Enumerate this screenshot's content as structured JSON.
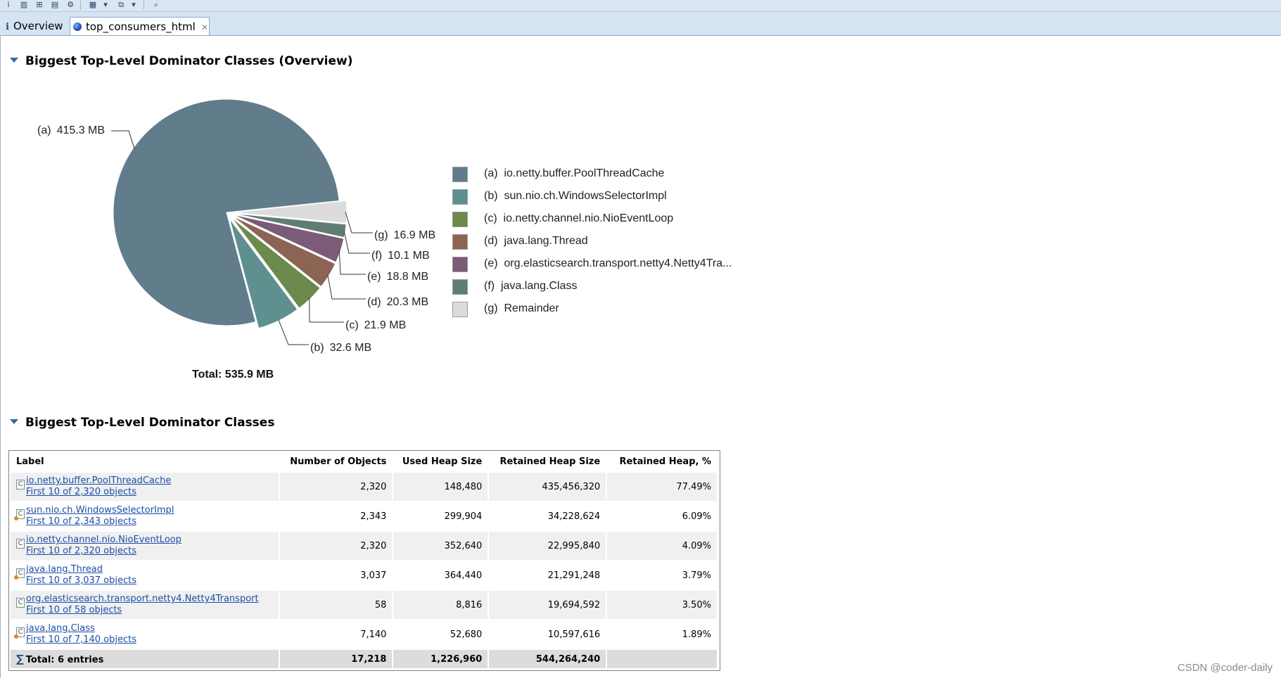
{
  "toolbar": {
    "icons": [
      "info-icon",
      "histogram-icon",
      "dominator-tree-icon",
      "oql-icon",
      "settings-icon",
      "query-browser-icon",
      "dropdown-icon",
      "heap-dump-overview-icon",
      "dropdown-icon",
      "search-icon"
    ]
  },
  "tabs": [
    {
      "label": "Overview",
      "icon": "info-icon"
    },
    {
      "label": "top_consumers_html",
      "icon": "globe-icon",
      "active": true
    }
  ],
  "section1": {
    "title": "Biggest Top-Level Dominator Classes (Overview)"
  },
  "section2": {
    "title": "Biggest Top-Level Dominator Classes"
  },
  "chart_data": {
    "type": "pie",
    "total_label": "Total: 535.9 MB",
    "slices": [
      {
        "key": "(a)",
        "name": "io.netty.buffer.PoolThreadCache",
        "value_mb": 415.3,
        "label": "415.3 MB",
        "color": "#617d8c"
      },
      {
        "key": "(b)",
        "name": "sun.nio.ch.WindowsSelectorImpl",
        "value_mb": 32.6,
        "label": "32.6 MB",
        "color": "#5f9090"
      },
      {
        "key": "(c)",
        "name": "io.netty.channel.nio.NioEventLoop",
        "value_mb": 21.9,
        "label": "21.9 MB",
        "color": "#6b8a4c"
      },
      {
        "key": "(d)",
        "name": "java.lang.Thread",
        "value_mb": 20.3,
        "label": "20.3 MB",
        "color": "#8c6454"
      },
      {
        "key": "(e)",
        "name": "org.elasticsearch.transport.netty4.Netty4Tra...",
        "value_mb": 18.8,
        "label": "18.8 MB",
        "color": "#7a5b78"
      },
      {
        "key": "(f)",
        "name": "java.lang.Class",
        "value_mb": 10.1,
        "label": "10.1 MB",
        "color": "#5f7d70"
      },
      {
        "key": "(g)",
        "name": "Remainder",
        "value_mb": 16.9,
        "label": "16.9 MB",
        "color": "#dcdcdc"
      }
    ]
  },
  "table": {
    "columns": [
      "Label",
      "Number of Objects",
      "Used Heap Size",
      "Retained Heap Size",
      "Retained Heap, %"
    ],
    "rows": [
      {
        "name": "io.netty.buffer.PoolThreadCache",
        "sub": "First 10 of 2,320 objects",
        "objects": "2,320",
        "used": "148,480",
        "retained": "435,456,320",
        "pct": "77.49%",
        "icon_dot": false
      },
      {
        "name": "sun.nio.ch.WindowsSelectorImpl",
        "sub": "First 10 of 2,343 objects",
        "objects": "2,343",
        "used": "299,904",
        "retained": "34,228,624",
        "pct": "6.09%",
        "icon_dot": true
      },
      {
        "name": "io.netty.channel.nio.NioEventLoop",
        "sub": "First 10 of 2,320 objects",
        "objects": "2,320",
        "used": "352,640",
        "retained": "22,995,840",
        "pct": "4.09%",
        "icon_dot": false
      },
      {
        "name": "java.lang.Thread",
        "sub": "First 10 of 3,037 objects",
        "objects": "3,037",
        "used": "364,440",
        "retained": "21,291,248",
        "pct": "3.79%",
        "icon_dot": true
      },
      {
        "name": "org.elasticsearch.transport.netty4.Netty4Transport",
        "sub": "First 10 of 58 objects",
        "objects": "58",
        "used": "8,816",
        "retained": "19,694,592",
        "pct": "3.50%",
        "icon_dot": false
      },
      {
        "name": "java.lang.Class",
        "sub": "First 10 of 7,140 objects",
        "objects": "7,140",
        "used": "52,680",
        "retained": "10,597,616",
        "pct": "1.89%",
        "icon_dot": true
      }
    ],
    "total": {
      "label": "Total: 6 entries",
      "objects": "17,218",
      "used": "1,226,960",
      "retained": "544,264,240",
      "pct": ""
    }
  },
  "watermark": "CSDN @coder-daily"
}
